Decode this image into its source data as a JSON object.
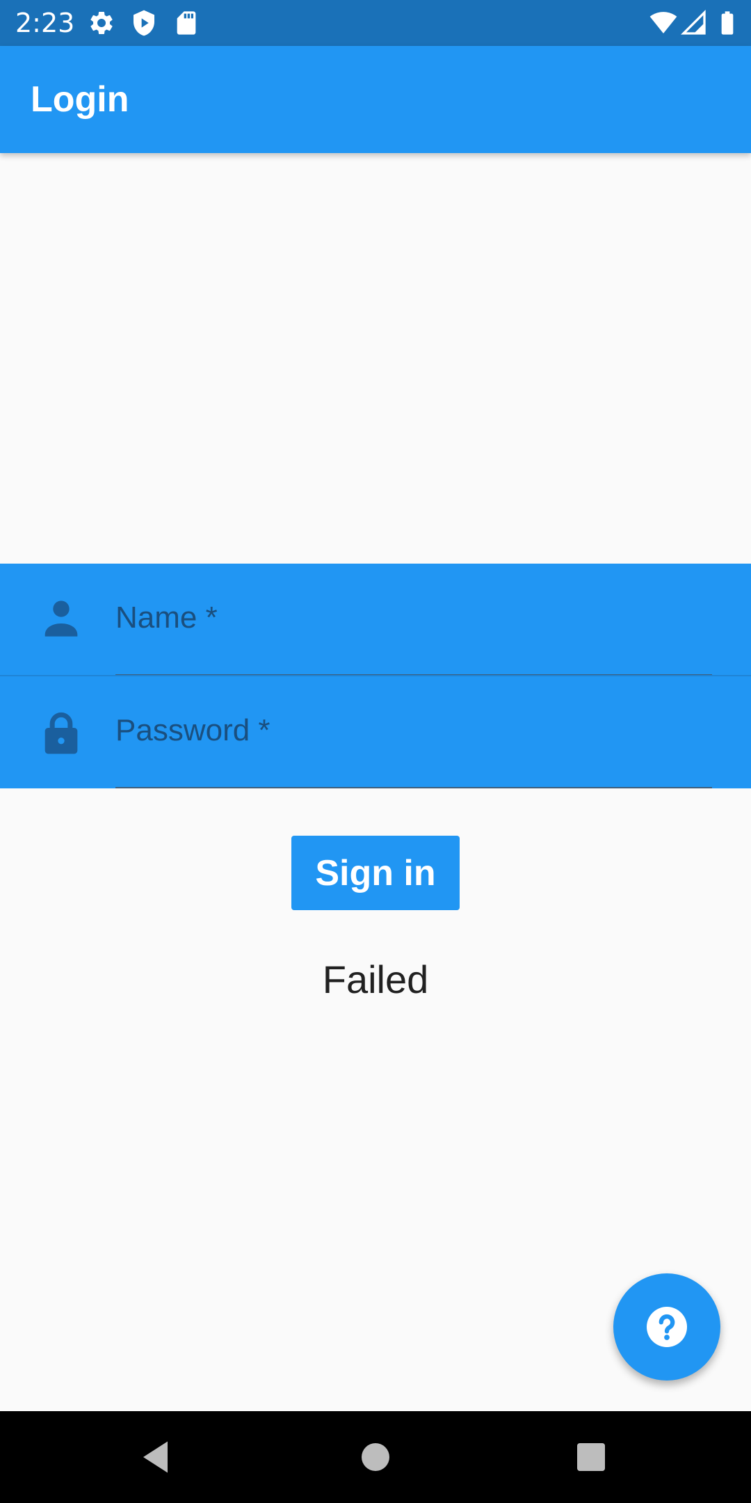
{
  "status_bar": {
    "time": "2:23",
    "icons": [
      "gear-icon",
      "shield-play-icon",
      "sd-card-icon",
      "wifi-icon",
      "signal-icon",
      "battery-icon"
    ]
  },
  "app_bar": {
    "title": "Login"
  },
  "form": {
    "name_field": {
      "label": "Name *",
      "icon": "person-icon"
    },
    "password_field": {
      "label": "Password *",
      "icon": "lock-icon"
    },
    "sign_in_label": "Sign in",
    "status_message": "Failed"
  },
  "fab": {
    "icon": "help-icon"
  },
  "nav_bar": {
    "buttons": [
      "back-icon",
      "home-icon",
      "recents-icon"
    ]
  },
  "colors": {
    "primary": "#2196f3",
    "status_bar": "#1a71b8",
    "background": "#fafafa",
    "field_icon": "#1a5f9e"
  }
}
